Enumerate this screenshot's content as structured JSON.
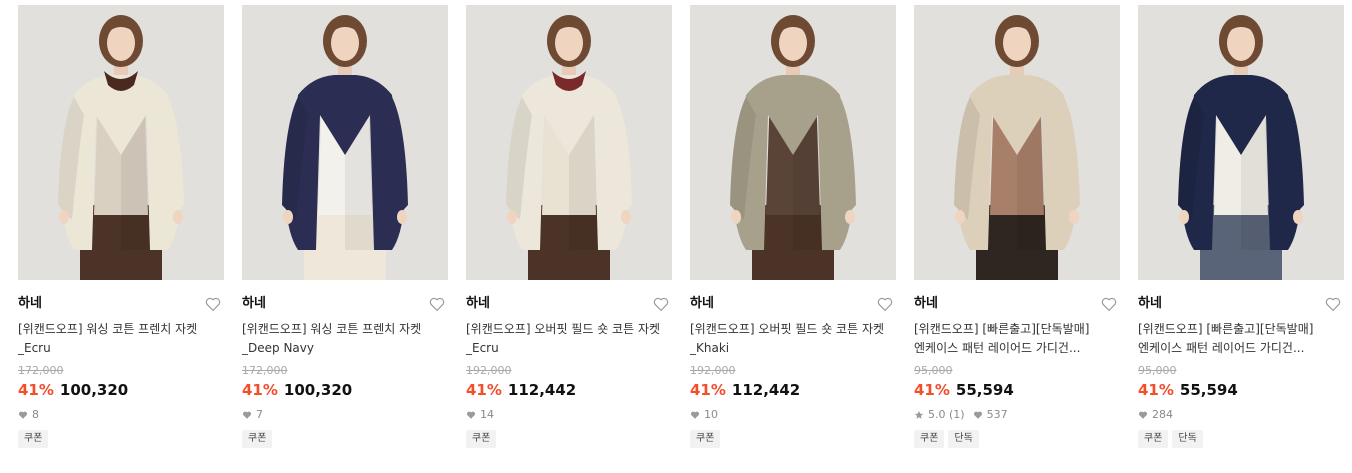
{
  "colors": {
    "discount": "#f34e2b",
    "original_price": "#a9a9a9",
    "meta": "#8a8a8a",
    "tag_bg": "#f2f2f2"
  },
  "products": [
    {
      "brand": "하네",
      "title": "[위캔드오프] 워싱 코튼 프렌치 자켓_Ecru",
      "original_price": "172,000",
      "discount": "41%",
      "price": "100,320",
      "rating": "",
      "likes": "8",
      "tags": [
        "쿠폰"
      ],
      "garment_color": "#ece6d6",
      "inner_color": "#d9d0c2",
      "scarf_color": "#4a2a1e",
      "bottom_color": "#4b3327"
    },
    {
      "brand": "하네",
      "title": "[위캔드오프] 워싱 코튼 프렌치 자켓_Deep Navy",
      "original_price": "172,000",
      "discount": "41%",
      "price": "100,320",
      "rating": "",
      "likes": "7",
      "tags": [
        "쿠폰"
      ],
      "garment_color": "#2b2e52",
      "inner_color": "#f3f1ec",
      "scarf_color": "",
      "bottom_color": "#efe8da"
    },
    {
      "brand": "하네",
      "title": "[위캔드오프] 오버핏 필드 숏 코튼 자켓_Ecru",
      "original_price": "192,000",
      "discount": "41%",
      "price": "112,442",
      "rating": "",
      "likes": "14",
      "tags": [
        "쿠폰"
      ],
      "garment_color": "#ece7da",
      "inner_color": "#e9e2d3",
      "scarf_color": "#7a2a2a",
      "bottom_color": "#4b3327"
    },
    {
      "brand": "하네",
      "title": "[위캔드오프] 오버핏 필드 숏 코튼 자켓_Khaki",
      "original_price": "192,000",
      "discount": "41%",
      "price": "112,442",
      "rating": "",
      "likes": "10",
      "tags": [
        "쿠폰"
      ],
      "garment_color": "#a7a08a",
      "inner_color": "#5a4438",
      "scarf_color": "",
      "bottom_color": "#4b3327"
    },
    {
      "brand": "하네",
      "title": "[위캔드오프] [빠른출고][단독발매] 엔케이스 패턴 레이어드 가디건...",
      "original_price": "95,000",
      "discount": "41%",
      "price": "55,594",
      "rating": "5.0 (1)",
      "likes": "537",
      "tags": [
        "쿠폰",
        "단독"
      ],
      "garment_color": "#ddd0bb",
      "inner_color": "#a8806a",
      "scarf_color": "",
      "bottom_color": "#2f2621"
    },
    {
      "brand": "하네",
      "title": "[위캔드오프] [빠른출고][단독발매] 엔케이스 패턴 레이어드 가디건...",
      "original_price": "95,000",
      "discount": "41%",
      "price": "55,594",
      "rating": "",
      "likes": "284",
      "tags": [
        "쿠폰",
        "단독"
      ],
      "garment_color": "#1f2848",
      "inner_color": "#f0ede6",
      "scarf_color": "",
      "bottom_color": "#5a6478"
    }
  ]
}
